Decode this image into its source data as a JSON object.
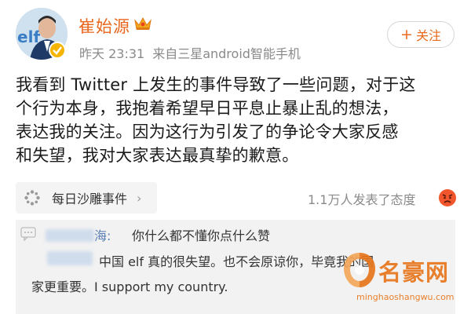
{
  "header": {
    "user_name": "崔始源",
    "time": "昨天 23:31",
    "source": "来自三星android智能手机",
    "follow_label": "关注",
    "follow_plus": "+"
  },
  "post": {
    "lines": [
      "我看到 Twitter 上发生的事件导致了一些问题，对于这",
      "个行为本身，我抱着希望早日平息止暴止乱的想法，",
      "表达我的关注。因为这行为引发了的争论令大家反感",
      "和失望，我对大家表达最真挚的歉意。"
    ]
  },
  "topic": {
    "label": "每日沙雕事件",
    "arrow": "›",
    "reaction_text": "1.1万人发表了态度"
  },
  "comments": [
    {
      "user_suffix": "海:",
      "text": "你什么都不懂你点什么赞"
    },
    {
      "text_line1": "中国 elf 真的很失望。也不会原谅你，毕竟我的国",
      "text_line2": "家更重要。I support my country."
    }
  ],
  "watermark": {
    "title": "名豪网",
    "url": "minghaoshangwu.com"
  },
  "colors": {
    "name_orange": "#e8661c",
    "link_blue": "#5a7fb5",
    "meta_gray": "#8a8a8a",
    "comment_bg": "#f2f2f2"
  },
  "icons": [
    "avatar",
    "verified-badge-icon",
    "crown-icon",
    "topic-icon",
    "angry-face-icon",
    "comment-quote-icon",
    "watermark-logo-icon"
  ]
}
